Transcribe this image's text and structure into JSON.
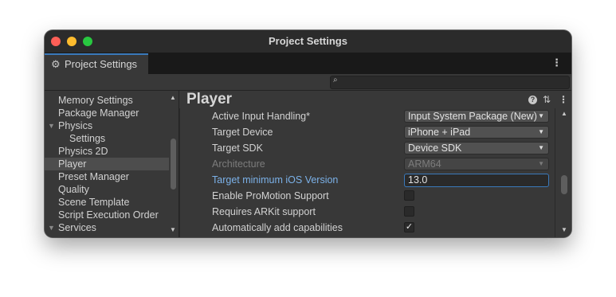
{
  "window": {
    "title": "Project Settings"
  },
  "tab": {
    "label": "Project Settings",
    "icon": "gear-icon"
  },
  "search": {
    "placeholder": "",
    "icon": "search-icon"
  },
  "sidebar": {
    "items": [
      {
        "label": "Memory Settings",
        "selected": false,
        "expander": ""
      },
      {
        "label": "Package Manager",
        "selected": false,
        "expander": ""
      },
      {
        "label": "Physics",
        "selected": false,
        "expander": "▼"
      },
      {
        "label": "Settings",
        "selected": false,
        "expander": ""
      },
      {
        "label": "Physics 2D",
        "selected": false,
        "expander": ""
      },
      {
        "label": "Player",
        "selected": true,
        "expander": ""
      },
      {
        "label": "Preset Manager",
        "selected": false,
        "expander": ""
      },
      {
        "label": "Quality",
        "selected": false,
        "expander": ""
      },
      {
        "label": "Scene Template",
        "selected": false,
        "expander": ""
      },
      {
        "label": "Script Execution Order",
        "selected": false,
        "expander": ""
      },
      {
        "label": "Services",
        "selected": false,
        "expander": "▼"
      }
    ]
  },
  "panel": {
    "title": "Player",
    "icons": [
      "help-icon",
      "presets-icon",
      "more-icon"
    ],
    "rows": [
      {
        "label": "Active Input Handling*",
        "type": "dropdown",
        "value": "Input System Package (New)"
      },
      {
        "label": "Target Device",
        "type": "dropdown",
        "value": "iPhone + iPad"
      },
      {
        "label": "Target SDK",
        "type": "dropdown",
        "value": "Device SDK"
      },
      {
        "label": "Architecture",
        "type": "dropdown-disabled",
        "value": "ARM64"
      },
      {
        "label": "Target minimum iOS Version",
        "type": "text",
        "value": "13.0"
      },
      {
        "label": "Enable ProMotion Support",
        "type": "checkbox",
        "checked": false
      },
      {
        "label": "Requires ARKit support",
        "type": "checkbox",
        "checked": false
      },
      {
        "label": "Automatically add capabilities",
        "type": "checkbox",
        "checked": true
      }
    ]
  },
  "glyphs": {
    "check": "✓",
    "dropdown_arrow": "▼",
    "scroll_up": "▲",
    "scroll_down": "▼",
    "gear": "⚙",
    "kebab": "⋮",
    "search": "⌕",
    "help": "?",
    "sliders": "⇅"
  },
  "colors": {
    "accent": "#3a79bb",
    "focus_label": "#7bb1e8",
    "traffic_red": "#fe5f57",
    "traffic_yellow": "#febc2e",
    "traffic_green": "#28c840"
  }
}
